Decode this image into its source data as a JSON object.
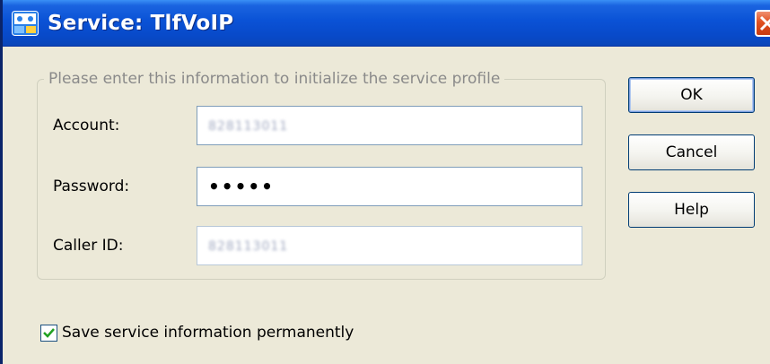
{
  "window": {
    "title": "Service: TlfVoIP",
    "icon": "service-app-icon",
    "close_icon": "close-icon"
  },
  "group": {
    "legend": "Please enter this information to initialize the service profile",
    "fields": {
      "account": {
        "label": "Account:",
        "value": "828113011"
      },
      "password": {
        "label": "Password:",
        "value": "•••••"
      },
      "caller_id": {
        "label": "Caller ID:",
        "value": "828113011"
      }
    }
  },
  "buttons": {
    "ok": "OK",
    "cancel": "Cancel",
    "help": "Help"
  },
  "save_option": {
    "label": "Save service information permanently",
    "checked": true
  },
  "colors": {
    "titlebar": "#0a52d6",
    "dialog_bg": "#ece9d8",
    "close_button": "#e05020",
    "field_border": "#7f9db9"
  }
}
